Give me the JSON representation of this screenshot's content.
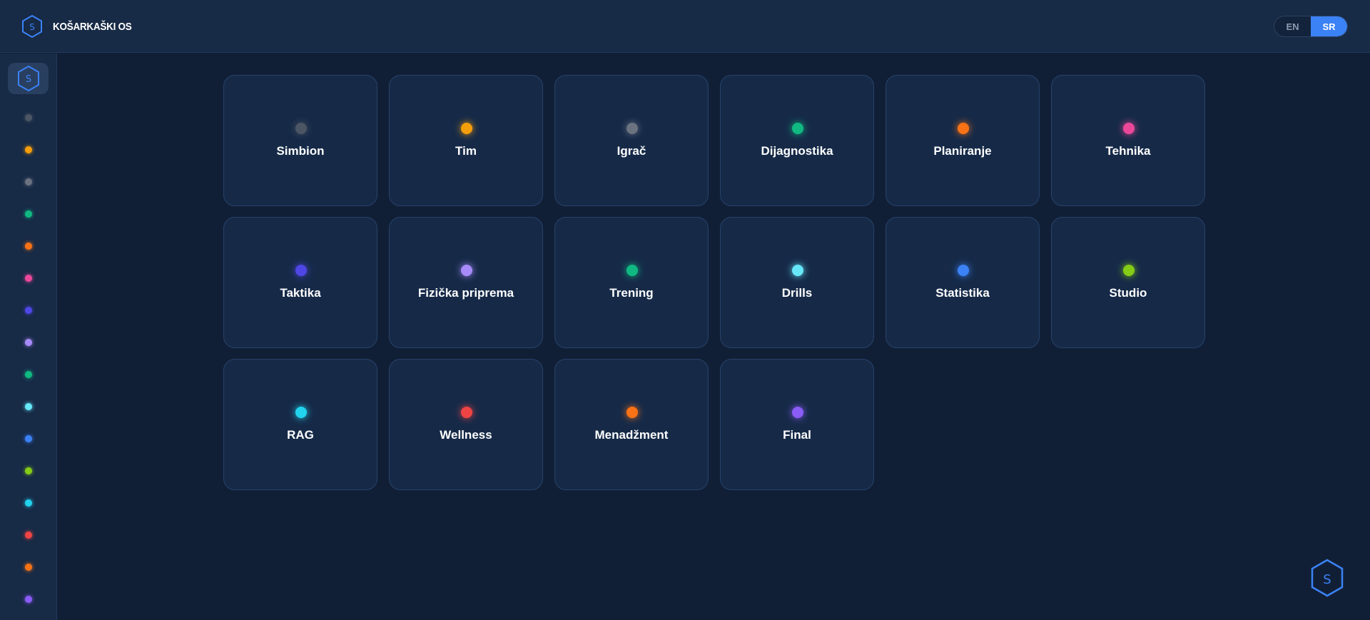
{
  "header": {
    "brand_title": "KOŠARKAŠKI OS",
    "brand_icon": "hexagon-s-logo",
    "lang": {
      "en_label": "EN",
      "sr_label": "SR",
      "active": "SR"
    }
  },
  "colors": {
    "accent": "#3b82f6",
    "background": "#111f36",
    "panel": "#162a48"
  },
  "sidebar": {
    "dots": [
      "#4b5563",
      "#f59e0b",
      "#6b7280",
      "#10b981",
      "#f97316",
      "#ec4899",
      "#4f46e5",
      "#a78bfa",
      "#10b981",
      "#67e8f9",
      "#3b82f6",
      "#84cc16",
      "#22d3ee",
      "#ef4444",
      "#f97316",
      "#8b5cf6"
    ]
  },
  "modules": [
    {
      "label": "Simbion",
      "color": "#4b5563"
    },
    {
      "label": "Tim",
      "color": "#f59e0b"
    },
    {
      "label": "Igrač",
      "color": "#6b7280"
    },
    {
      "label": "Dijagnostika",
      "color": "#10b981"
    },
    {
      "label": "Planiranje",
      "color": "#f97316"
    },
    {
      "label": "Tehnika",
      "color": "#ec4899"
    },
    {
      "label": "Taktika",
      "color": "#4f46e5"
    },
    {
      "label": "Fizička priprema",
      "color": "#a78bfa"
    },
    {
      "label": "Trening",
      "color": "#10b981"
    },
    {
      "label": "Drills",
      "color": "#67e8f9"
    },
    {
      "label": "Statistika",
      "color": "#3b82f6"
    },
    {
      "label": "Studio",
      "color": "#84cc16"
    },
    {
      "label": "RAG",
      "color": "#22d3ee"
    },
    {
      "label": "Wellness",
      "color": "#ef4444"
    },
    {
      "label": "Menadžment",
      "color": "#f97316"
    },
    {
      "label": "Final",
      "color": "#8b5cf6"
    }
  ]
}
